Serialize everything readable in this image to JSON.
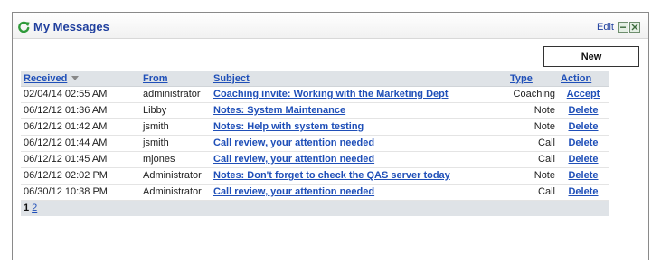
{
  "panel": {
    "title": "My Messages",
    "edit_label": "Edit",
    "new_button_label": "New"
  },
  "table": {
    "headers": {
      "received": "Received",
      "from": "From",
      "subject": "Subject",
      "type": "Type",
      "action": "Action"
    },
    "rows": [
      {
        "received": "02/04/14 02:55 AM",
        "from": "administrator",
        "subject": "Coaching invite: Working with the Marketing Dept",
        "type": "Coaching",
        "action": "Accept"
      },
      {
        "received": "06/12/12 01:36 AM",
        "from": "Libby",
        "subject": "Notes: System Maintenance",
        "type": "Note",
        "action": "Delete"
      },
      {
        "received": "06/12/12 01:42 AM",
        "from": "jsmith",
        "subject": "Notes: Help with system testing",
        "type": "Note",
        "action": "Delete"
      },
      {
        "received": "06/12/12 01:44 AM",
        "from": "jsmith",
        "subject": "Call review, your attention needed",
        "type": "Call",
        "action": "Delete"
      },
      {
        "received": "06/12/12 01:45 AM",
        "from": "mjones",
        "subject": "Call review, your attention needed",
        "type": "Call",
        "action": "Delete"
      },
      {
        "received": "06/12/12 02:02 PM",
        "from": "Administrator",
        "subject": "Notes: Don't forget to check the QAS server today",
        "type": "Note",
        "action": "Delete"
      },
      {
        "received": "06/30/12 10:38 PM",
        "from": "Administrator",
        "subject": "Call review, your attention needed",
        "type": "Call",
        "action": "Delete"
      }
    ]
  },
  "pager": {
    "current": "1",
    "pages": [
      "2"
    ]
  },
  "colors": {
    "link": "#1f4fb8",
    "title": "#1f3f9e",
    "header_bg": "#dfe3e7",
    "refresh_icon": "#2f9a3a"
  },
  "icons": {
    "refresh": "refresh-icon",
    "minimize": "minimize-icon",
    "close": "close-icon",
    "sort": "sort-down-icon"
  }
}
